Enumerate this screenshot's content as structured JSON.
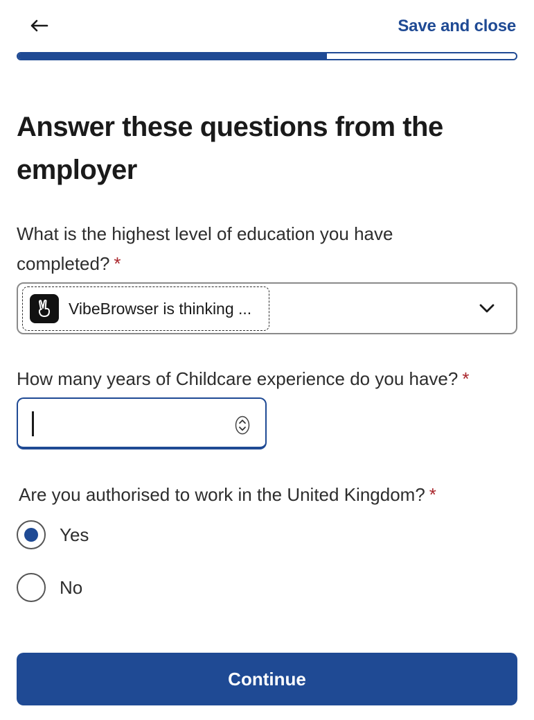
{
  "header": {
    "back_icon": "arrow-left-icon",
    "save_close_label": "Save and close"
  },
  "progress": {
    "fraction": 0.62
  },
  "title": "Answer these questions from the employer",
  "questions": [
    {
      "label": "What is the highest level of education you have completed?",
      "required_mark": "*",
      "type": "select",
      "overlay_text": "VibeBrowser is thinking ...",
      "overlay_icon": "victory-hand-icon",
      "dropdown_icon": "chevron-down-icon"
    },
    {
      "label": "How many years of Childcare experience do you have?",
      "required_mark": "*",
      "type": "number",
      "value": "",
      "stepper_icon": "stepper-icon"
    },
    {
      "label": "Are you authorised to work in the United Kingdom?",
      "required_mark": "*",
      "type": "radio",
      "options": [
        {
          "label": "Yes",
          "checked": true
        },
        {
          "label": "No",
          "checked": false
        }
      ]
    }
  ],
  "continue_label": "Continue",
  "colors": {
    "accent": "#1f4a94",
    "required": "#a9252b",
    "text": "#2d2d2d"
  }
}
